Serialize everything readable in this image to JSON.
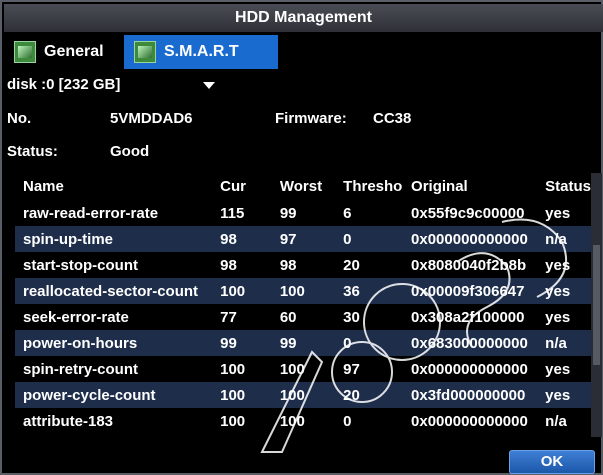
{
  "window": {
    "title": "HDD Management"
  },
  "tabs": [
    {
      "label": "General",
      "icon": "hdd-icon"
    },
    {
      "label": "S.M.A.R.T",
      "icon": "hdd-icon"
    }
  ],
  "disk_select": {
    "value": "disk :0 [232 GB]"
  },
  "info": {
    "no_label": "No.",
    "no_value": "5VMDDAD6",
    "firmware_label": "Firmware:",
    "firmware_value": "CC38",
    "status_label": "Status:",
    "status_value": "Good"
  },
  "table": {
    "headers": [
      "Name",
      "Cur",
      "Worst",
      "Thresho",
      "Original",
      "Status"
    ],
    "rows": [
      [
        "raw-read-error-rate",
        "115",
        "99",
        "6",
        "0x55f9c9c00000",
        "yes"
      ],
      [
        "spin-up-time",
        "98",
        "97",
        "0",
        "0x000000000000",
        "n/a"
      ],
      [
        "start-stop-count",
        "98",
        "98",
        "20",
        "0x8080040f2b8b",
        "yes"
      ],
      [
        "reallocated-sector-count",
        "100",
        "100",
        "36",
        "0x00009f306647",
        "yes"
      ],
      [
        "seek-error-rate",
        "77",
        "60",
        "30",
        "0x308a2f100000",
        "yes"
      ],
      [
        "power-on-hours",
        "99",
        "99",
        "0",
        "0x683000000000",
        "n/a"
      ],
      [
        "spin-retry-count",
        "100",
        "100",
        "97",
        "0x000000000000",
        "yes"
      ],
      [
        "power-cycle-count",
        "100",
        "100",
        "20",
        "0x3fd000000000",
        "yes"
      ],
      [
        "attribute-183",
        "100",
        "100",
        "0",
        "0x000000000000",
        "n/a"
      ]
    ]
  },
  "buttons": {
    "ok": "OK"
  },
  "colors": {
    "accent": "#1a6bd0",
    "alt_row": "#1d2d4a",
    "background": "#000000"
  }
}
